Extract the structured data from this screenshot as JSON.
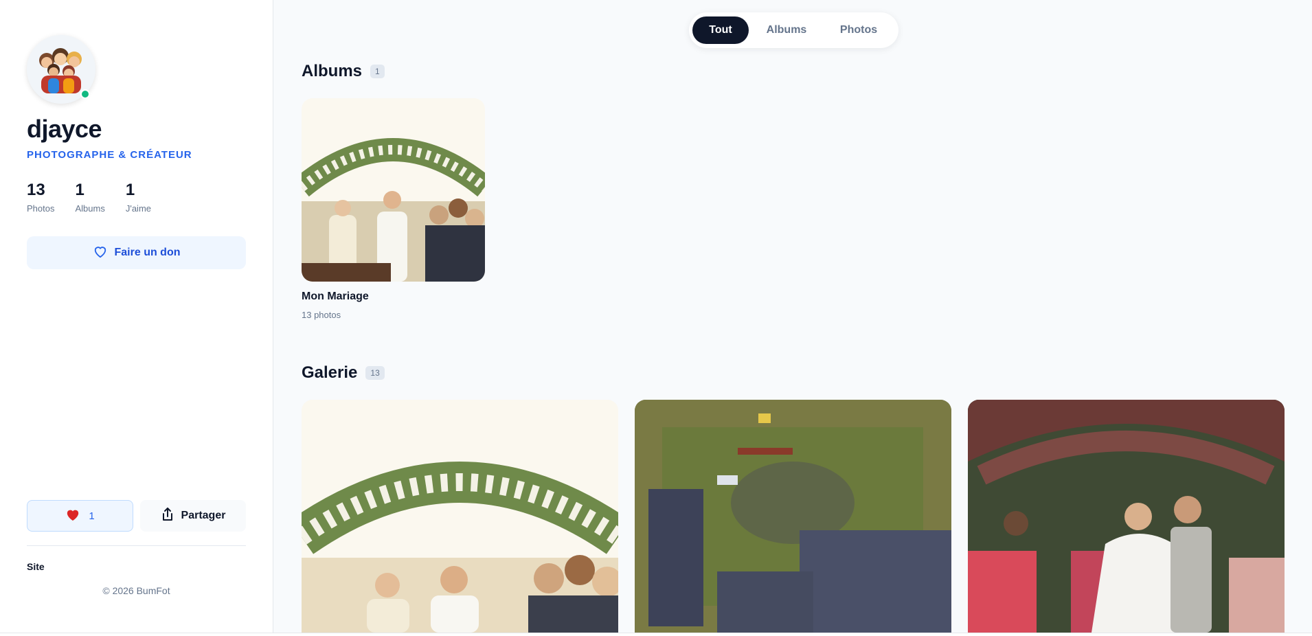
{
  "profile": {
    "username": "djayce",
    "role": "PHOTOGRAPHE & CRÉATEUR",
    "online": true,
    "stats": [
      {
        "value": "13",
        "label": "Photos"
      },
      {
        "value": "1",
        "label": "Albums"
      },
      {
        "value": "1",
        "label": "J'aime"
      }
    ],
    "donate_label": "Faire un don",
    "like_count": "1",
    "share_label": "Partager",
    "site_label": "Site",
    "copyright": "© 2026 BumFot"
  },
  "tabs": [
    {
      "label": "Tout",
      "active": true
    },
    {
      "label": "Albums",
      "active": false
    },
    {
      "label": "Photos",
      "active": false
    }
  ],
  "albums_section": {
    "title": "Albums",
    "count": "1",
    "items": [
      {
        "name": "Mon Mariage",
        "count_label": "13 photos"
      }
    ]
  },
  "gallery_section": {
    "title": "Galerie",
    "count": "13"
  },
  "colors": {
    "accent": "#2563eb",
    "dark": "#0f172a",
    "online": "#10b981",
    "heart": "#dc2626"
  }
}
